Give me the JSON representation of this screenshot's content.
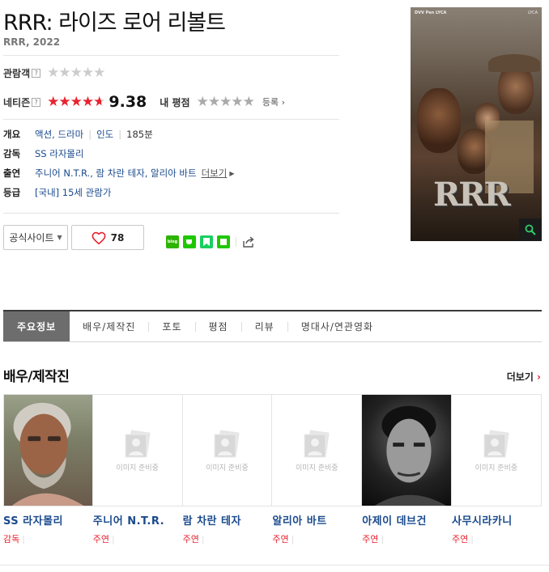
{
  "movie": {
    "title": "RRR: 라이즈 로어 리볼트",
    "subtitle": "RRR, 2022"
  },
  "ratings": {
    "audience_label": "관람객",
    "help_mark": "?",
    "audience_stars": 0,
    "netizen_label": "네티즌",
    "netizen_score": "9.38",
    "netizen_stars": 4.7,
    "my_label": "내 평점",
    "register": "등록",
    "star_color": "#e8232f"
  },
  "info": {
    "overview_label": "개요",
    "genre": "액션, 드라마",
    "country": "인도",
    "runtime": "185분",
    "director_label": "감독",
    "director": "SS 라자몰리",
    "cast_label": "출연",
    "cast": "주니어 N.T.R., 람 차란 테자, 알리아 바트",
    "more": "더보기",
    "grade_label": "등급",
    "grade": "[국내] 15세 관람가"
  },
  "actions": {
    "official_site": "공식사이트",
    "like_count": "78",
    "blog_badge": "blog"
  },
  "poster": {
    "top_text": "DVV  Pen  LYCA",
    "logo_text": "LYCA",
    "title_text": "RRR"
  },
  "tabs": [
    "주요정보",
    "배우/제작진",
    "포토",
    "평점",
    "리뷰",
    "명대사/연관영화"
  ],
  "section": {
    "title": "배우/제작진",
    "more": "더보기"
  },
  "placeholder_text": "이미지 준비중",
  "cast_list": [
    {
      "name": "SS 라자몰리",
      "role": "감독",
      "photo": "photo"
    },
    {
      "name": "주니어 N.T.R.",
      "role": "주연",
      "photo": "placeholder"
    },
    {
      "name": "람 차란 테자",
      "role": "주연",
      "photo": "placeholder"
    },
    {
      "name": "알리아 바트",
      "role": "주연",
      "photo": "placeholder"
    },
    {
      "name": "아제이 데브건",
      "role": "주연",
      "photo": "photo-bw"
    },
    {
      "name": "사무시라카니",
      "role": "주연",
      "photo": "placeholder"
    }
  ],
  "colors": {
    "accent": "#e8232f",
    "link": "#1a4a8c",
    "tab_active": "#6d6d6d"
  }
}
